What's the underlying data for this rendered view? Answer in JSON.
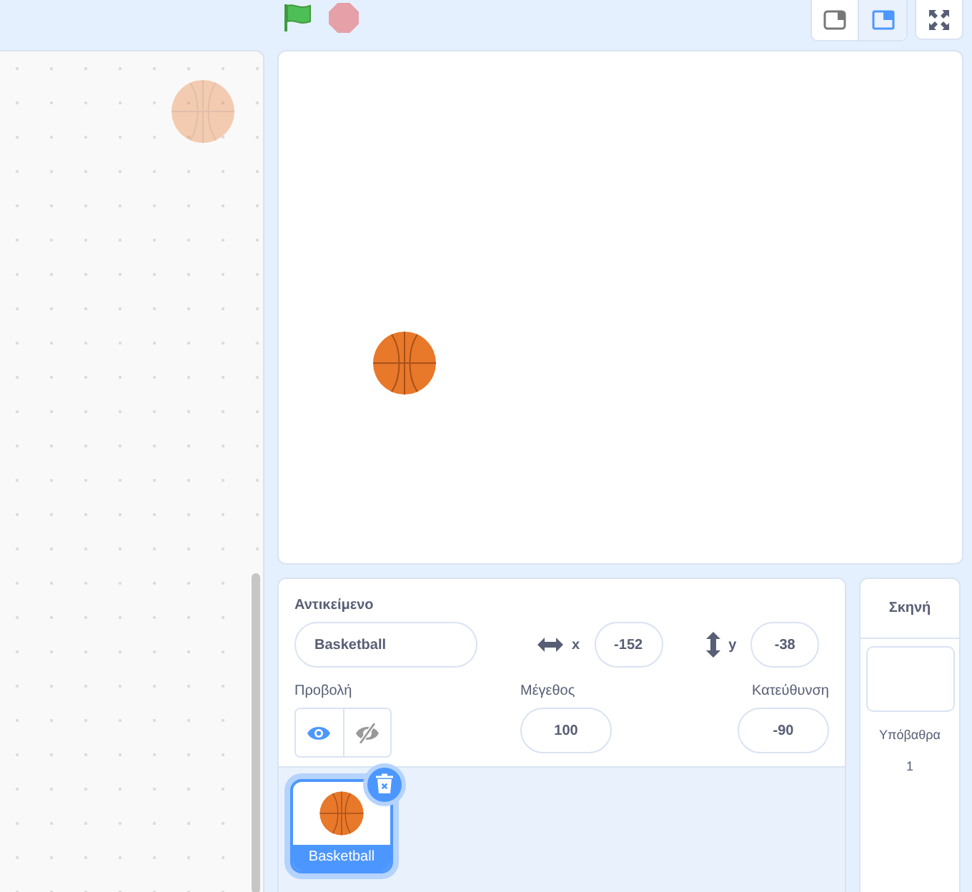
{
  "stage_size_modes": [
    {
      "selected": false
    },
    {
      "selected": true
    }
  ],
  "sprite_info": {
    "sprite_label": "Αντικείμενο",
    "sprite_name": "Basketball",
    "x_label": "x",
    "x_value": "-152",
    "y_label": "y",
    "y_value": "-38",
    "show_label": "Προβολή",
    "visible": true,
    "size_label": "Μέγεθος",
    "size_value": "100",
    "direction_label": "Κατεύθυνση",
    "direction_value": "-90"
  },
  "sprites": [
    {
      "name": "Basketball",
      "selected": true
    }
  ],
  "stage_pane": {
    "title": "Σκηνή",
    "backdrops_label": "Υπόβαθρα",
    "backdrops_count": "1"
  }
}
